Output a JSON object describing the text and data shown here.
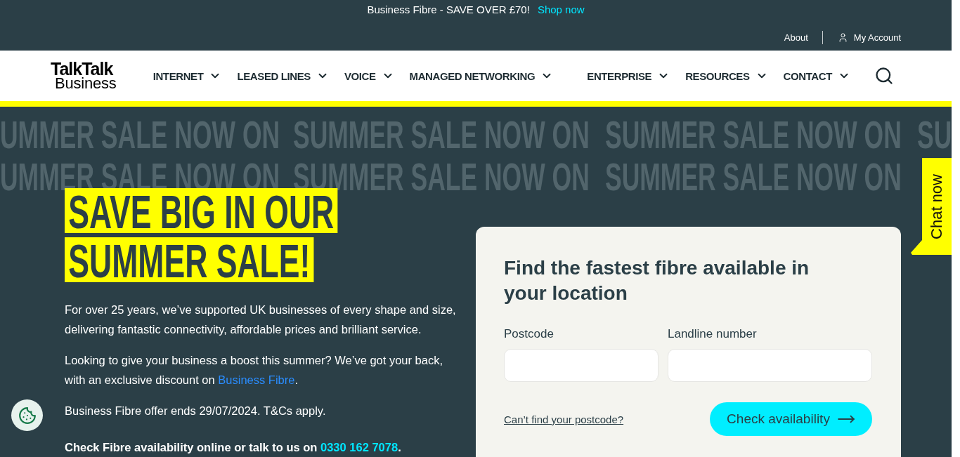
{
  "promo_bar": {
    "text": "Business Fibre - SAVE OVER £70!",
    "link": "Shop now"
  },
  "utility_links": [
    {
      "kind": "link",
      "label": "About"
    },
    {
      "kind": "account",
      "label": "My Account"
    }
  ],
  "logo": {
    "line_1": "TalkTalk",
    "line_2": "Business"
  },
  "nav": {
    "left": [
      {
        "label": "INTERNET",
        "expanded": false
      },
      {
        "label": "LEASED LINES",
        "expanded": false
      },
      {
        "label": "VOICE",
        "expanded": false
      },
      {
        "label": "MANAGED NETWORKING",
        "expanded": false
      }
    ],
    "right": [
      {
        "label": "ENTERPRISE",
        "expanded": false
      },
      {
        "label": "RESOURCES",
        "expanded": false
      },
      {
        "label": "CONTACT",
        "expanded": false
      }
    ]
  },
  "hero": {
    "background_slogans": [
      [
        "UMMER SALE NOW ON",
        "SUMMER SALE NOW ON",
        "SUMMER SALE NOW ON",
        "SU"
      ],
      [
        "UMMER SALE NOW ON",
        "SUMMER SALE NOW ON",
        "SUMMER SALE NOW ON"
      ]
    ],
    "heading_lines": [
      "SAVE BIG IN OUR",
      "SUMMER SALE!"
    ],
    "paragraphs": [
      {
        "kind": "plain",
        "text": "For over 25 years, we’ve supported UK businesses of every shape and size, delivering fantastic connectivity, affordable prices and brilliant service."
      },
      {
        "kind": "link",
        "before": "Looking to give your business a boost this summer? We’ve got your back, with an exclusive discount on ",
        "link": "Business Fibre",
        "after": "."
      },
      {
        "kind": "plain",
        "text": "Business Fibre offer ends 29/07/2024. T&Cs apply."
      },
      {
        "kind": "cta",
        "before": "Check Fibre availability online or talk to us on ",
        "link": "0330 162 7078",
        "after": "."
      }
    ]
  },
  "availability_form": {
    "title": "Find the fastest fibre available in your location",
    "fields": [
      {
        "label": "Postcode"
      },
      {
        "label": "Landline number"
      }
    ],
    "help_link": "Can’t find your postcode?",
    "submit": "Check availability"
  },
  "chat": {
    "label": "Chat now"
  }
}
